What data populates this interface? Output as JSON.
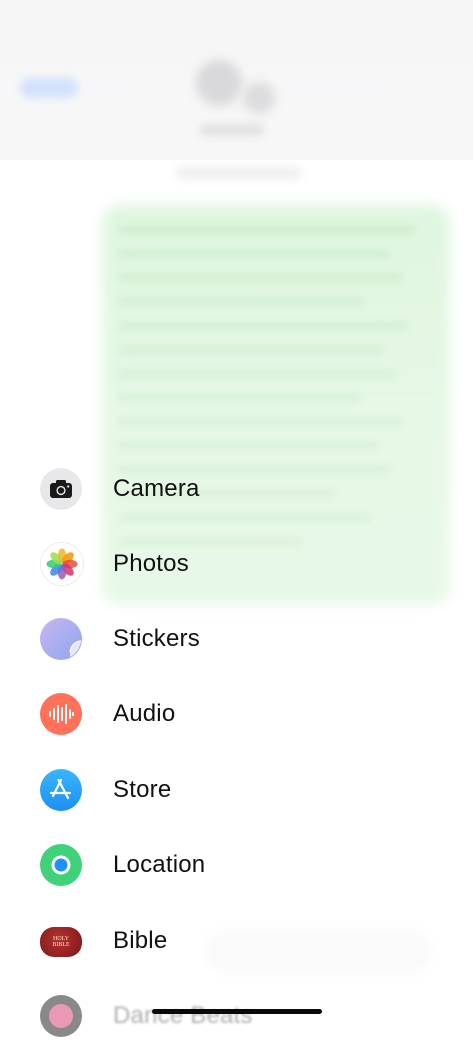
{
  "menu": {
    "items": [
      {
        "label": "Camera",
        "icon": "camera-icon",
        "color": "#e8e8ea"
      },
      {
        "label": "Photos",
        "icon": "photos-icon",
        "color": "#ffffff"
      },
      {
        "label": "Stickers",
        "icon": "stickers-icon",
        "color": "#a9b7f2"
      },
      {
        "label": "Audio",
        "icon": "audio-waveform-icon",
        "color": "#ff7259"
      },
      {
        "label": "Store",
        "icon": "app-store-icon",
        "color": "#2a9df4"
      },
      {
        "label": "Location",
        "icon": "location-icon",
        "color": "#3fd27a"
      },
      {
        "label": "Bible",
        "icon": "bible-icon",
        "color": "#8e1f1f",
        "icon_text": "HOLY BIBLE"
      },
      {
        "label": "Dance Beats",
        "icon": "app-icon",
        "color": "#d8467a"
      }
    ]
  },
  "colors": {
    "background": "#ffffff",
    "bubble": "#d9f4d9",
    "text": "#111111"
  }
}
